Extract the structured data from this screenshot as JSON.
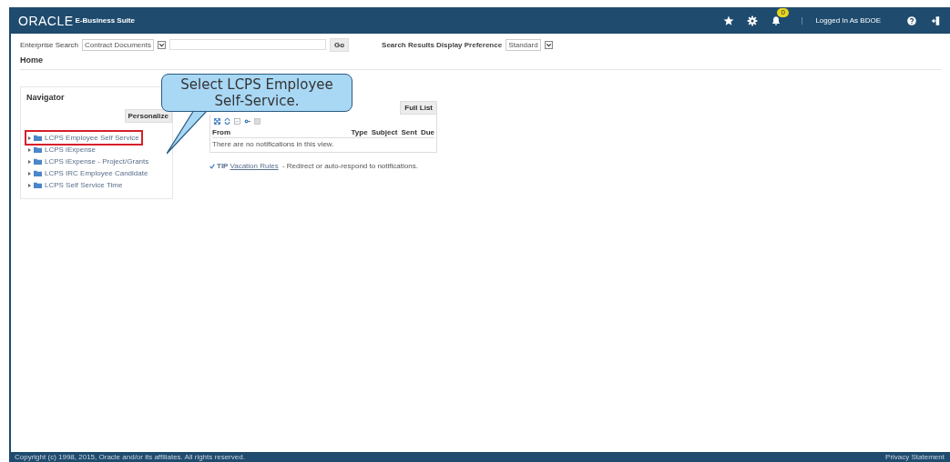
{
  "header": {
    "logo": "ORACLE",
    "product": "E-Business Suite",
    "badge_count": "0",
    "user": "Logged In As BDOE"
  },
  "search": {
    "label": "Enterprise Search",
    "category": "Contract Documents",
    "go": "Go",
    "pref_label": "Search Results Display Preference",
    "pref_value": "Standard"
  },
  "page_title": "Home",
  "navigator": {
    "title": "Navigator",
    "personalize": "Personalize",
    "items": [
      {
        "label": "LCPS Employee Self Service",
        "highlighted": true
      },
      {
        "label": "LCPS iExpense",
        "highlighted": false
      },
      {
        "label": "LCPS iExpense - Project/Grants",
        "highlighted": false
      },
      {
        "label": "LCPS IRC Employee Candidate",
        "highlighted": false
      },
      {
        "label": "LCPS Self Service Time",
        "highlighted": false
      }
    ]
  },
  "worklist": {
    "full_list": "Full List",
    "columns": [
      "From",
      "Type",
      "Subject",
      "Sent",
      "Due"
    ],
    "empty": "There are no notifications in this view.",
    "tip": "TIP",
    "tip_link": "Vacation Rules",
    "tip_text": " - Redirect or auto-respond to notifications."
  },
  "callout": {
    "text": "Select LCPS Employee Self-Service."
  },
  "footer": {
    "copyright": "Copyright (c) 1998, 2015, Oracle and/or its affiliates. All rights reserved.",
    "privacy": "Privacy Statement"
  }
}
